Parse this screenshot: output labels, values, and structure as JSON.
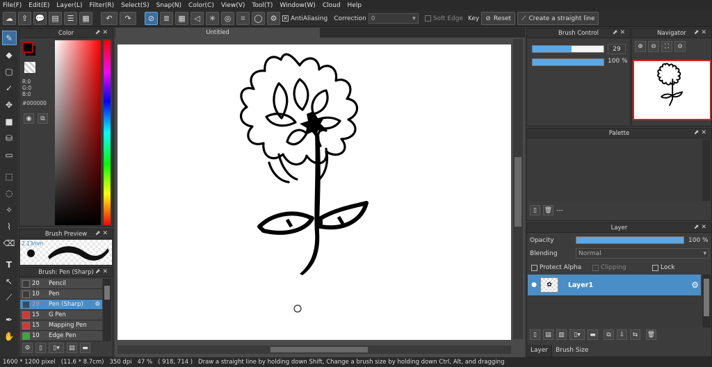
{
  "menu": [
    "File(F)",
    "Edit(E)",
    "Layer(L)",
    "Filter(R)",
    "Select(S)",
    "Snap(N)",
    "Color(C)",
    "View(V)",
    "Tool(T)",
    "Window(W)",
    "Cloud",
    "Help"
  ],
  "toolbar": {
    "antialiasing": "AntiAliasing",
    "correction_label": "Correction",
    "correction_value": "0",
    "soft_edge": "Soft Edge",
    "key_label": "Key",
    "reset": "Reset",
    "straight_line": "Create a straight line"
  },
  "color_panel": {
    "title": "Color",
    "r": "R:0",
    "g": "G:0",
    "b": "B:0",
    "hex": "#000000",
    "fg_color": "#000000",
    "accent_border": "#cc0000"
  },
  "brush_preview": {
    "title": "Brush Preview",
    "size": "2.13mm"
  },
  "brush_list": {
    "title": "Brush: Pen (Sharp)",
    "items": [
      {
        "size": "20",
        "name": "Pencil",
        "color": "#3a3a3a"
      },
      {
        "size": "10",
        "name": "Pen",
        "color": "#3a3a3a"
      },
      {
        "size": "29",
        "name": "Pen (Sharp)",
        "color": "#2f4f6f",
        "selected": true
      },
      {
        "size": "15",
        "name": "G Pen",
        "color": "#e03030"
      },
      {
        "size": "15",
        "name": "Mapping Pen",
        "color": "#e03030"
      },
      {
        "size": "10",
        "name": "Edge Pen",
        "color": "#30b030"
      }
    ]
  },
  "canvas": {
    "tab_title": "Untitled"
  },
  "brush_control": {
    "title": "Brush Control",
    "size_value": "29",
    "opacity_value": "100 %",
    "size_fraction": 0.55,
    "opacity_fraction": 1.0
  },
  "navigator": {
    "title": "Navigator"
  },
  "palette": {
    "title": "Palette",
    "dash": "---"
  },
  "layer_panel": {
    "title": "Layer",
    "opacity_label": "Opacity",
    "opacity_value": "100 %",
    "blending_label": "Blending",
    "blending_value": "Normal",
    "protect_alpha": "Protect Alpha",
    "clipping": "Clipping",
    "lock": "Lock",
    "layer_name": "Layer1",
    "tab_layer": "Layer",
    "tab_brush_size": "Brush Size"
  },
  "status": {
    "dimensions": "1600 * 1200 pixel",
    "cm": "(11.6 * 8.7cm)",
    "dpi": "350 dpi",
    "zoom": "47 %",
    "coords": "( 918, 714 )",
    "hint": "Draw a straight line by holding down Shift, Change a brush size by holding down Ctrl, Alt, and dragging"
  }
}
